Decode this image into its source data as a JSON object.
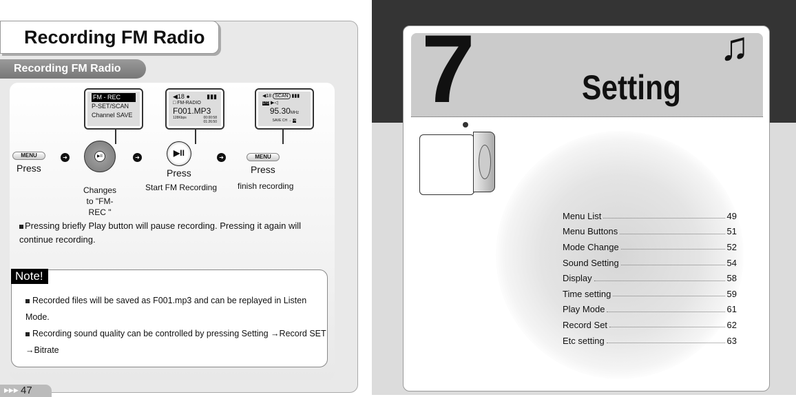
{
  "left_page": {
    "title": "Recording FM Radio",
    "subtitle": "Recording FM Radio",
    "screens": [
      {
        "lines": [
          "FM - REC",
          "P-SET/SCAN",
          "Channel SAVE"
        ]
      },
      {
        "volume": "18",
        "folder": "FM-RADIO",
        "file": "F001.MP3",
        "bitrate": "128Kbps",
        "time1": "00:00:58",
        "time2": "01:26:50"
      },
      {
        "volume": "18",
        "mode": "SCAN",
        "stereo": "STD",
        "freq": "95.30",
        "unit": "MHz",
        "save": "SAVE CH",
        "ch": "06"
      }
    ],
    "steps": [
      {
        "button": "MENU",
        "action": "Press"
      },
      {
        "caption": "Changes to \"FM-REC \""
      },
      {
        "action": "Press",
        "caption": "Start FM Recording"
      },
      {
        "button": "MENU",
        "action": "Press",
        "caption": "finish recording"
      }
    ],
    "bullet": "Pressing briefly Play button will pause recording. Pressing it again will continue recording.",
    "note": {
      "label": "Note!",
      "items": [
        "Recorded files will be saved as F001.mp3 and can be replayed in Listen Mode.",
        "Recording sound quality can be controlled by pressing Setting →Record SET →Bitrate"
      ]
    },
    "page_number": "47"
  },
  "right_page": {
    "chapter": "7",
    "title": "Setting",
    "toc": [
      {
        "label": "Menu List",
        "page": "49"
      },
      {
        "label": "Menu Buttons",
        "page": "51"
      },
      {
        "label": "Mode Change",
        "page": "52"
      },
      {
        "label": "Sound Setting",
        "page": "54"
      },
      {
        "label": "Display",
        "page": "58"
      },
      {
        "label": "Time setting",
        "page": "59"
      },
      {
        "label": "Play Mode",
        "page": "61"
      },
      {
        "label": "Record Set",
        "page": "62"
      },
      {
        "label": "Etc setting",
        "page": "63"
      }
    ]
  }
}
